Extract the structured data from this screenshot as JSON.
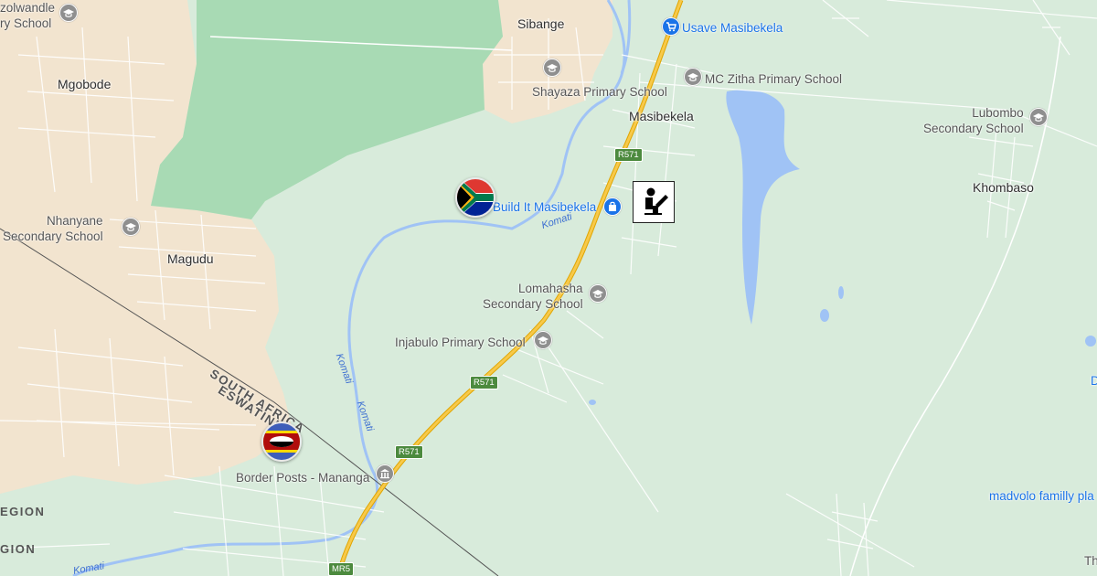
{
  "map": {
    "towns": [
      {
        "id": "sibange",
        "name": "Sibange"
      },
      {
        "id": "mgobode",
        "name": "Mgobode"
      },
      {
        "id": "magudu",
        "name": "Magudu"
      },
      {
        "id": "masibekela",
        "name": "Masibekela"
      },
      {
        "id": "khombaso",
        "name": "Khombaso"
      }
    ],
    "pois": [
      {
        "id": "usave",
        "name": "Usave Masibekela",
        "type": "shopping-cart-icon"
      },
      {
        "id": "shayaza",
        "name": "Shayaza Primary School",
        "type": "school-icon"
      },
      {
        "id": "mczitha",
        "name": "MC Zitha Primary School",
        "type": "school-icon"
      },
      {
        "id": "lubombo",
        "name": "Lubombo\nSecondary School",
        "type": "school-icon"
      },
      {
        "id": "nhanyane",
        "name": "Nhanyane\nSecondary School",
        "type": "school-icon"
      },
      {
        "id": "buildit",
        "name": "Build It Masibekela",
        "type": "shopping-bag-icon"
      },
      {
        "id": "lomahasha",
        "name": "Lomahasha\nSecondary School",
        "type": "school-icon"
      },
      {
        "id": "injabulo",
        "name": "Injabulo Primary School",
        "type": "school-icon"
      },
      {
        "id": "border",
        "name": "Border Posts - Mananga",
        "type": "government-building-icon"
      },
      {
        "id": "zolwandle",
        "name": "zolwandle\nry School",
        "type": "school-icon"
      },
      {
        "id": "madvolo",
        "name": "madvolo familly pla",
        "type": "place"
      }
    ],
    "roads": [
      {
        "id": "r571a",
        "name": "R571"
      },
      {
        "id": "r571b",
        "name": "R571"
      },
      {
        "id": "r571c",
        "name": "R571"
      },
      {
        "id": "mr5",
        "name": "MR5"
      }
    ],
    "rivers": [
      {
        "id": "komati1",
        "name": "Komati"
      },
      {
        "id": "komati2",
        "name": "Komati"
      },
      {
        "id": "komati3",
        "name": "Komati"
      },
      {
        "id": "komati4",
        "name": "Komati"
      }
    ],
    "border_labels": {
      "north": "SOUTH AFRICA",
      "south": "ESWATINI"
    },
    "regions": [
      "EGION",
      "GION"
    ],
    "edge_text": [
      "Th",
      "D"
    ],
    "flags": [
      {
        "id": "south-africa",
        "country": "South Africa"
      },
      {
        "id": "eswatini",
        "country": "Eswatini"
      }
    ],
    "colors": {
      "land": "#d8ebdb",
      "urban": "#f2e4cf",
      "park": "#a8dab4",
      "water": "#a0c3f5",
      "road": "#f7c94a",
      "poi_blue": "#1a73e8"
    }
  }
}
